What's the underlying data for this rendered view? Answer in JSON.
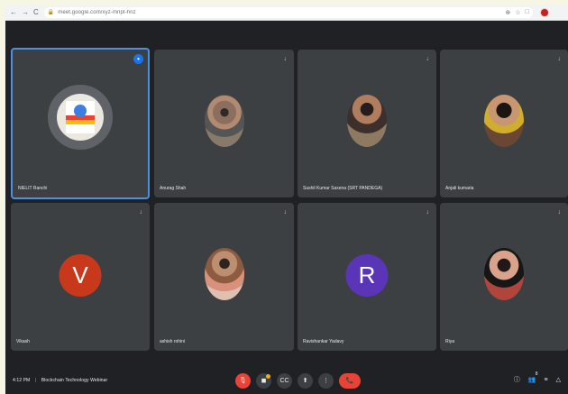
{
  "browser": {
    "url": "meet.google.com/xyz-mnpt-hnz",
    "nav_back_icon": "←",
    "nav_forward_icon": "→",
    "reload_icon": "C",
    "lock_icon": "🔒",
    "star_icon": "☆",
    "extension_icon": "⊕",
    "puzzle_icon": "□"
  },
  "participants": [
    {
      "name": "NIELIT Ranchi",
      "avatar_type": "logo",
      "active": true
    },
    {
      "name": "Anurag Shah",
      "avatar_type": "photo",
      "photo_style": "p1"
    },
    {
      "name": "Sushil Kumar Saxena (SRT PANDEGA)",
      "avatar_type": "photo",
      "photo_style": "p2"
    },
    {
      "name": "Anjali kumaria",
      "avatar_type": "photo",
      "photo_style": "p3"
    },
    {
      "name": "Vikash",
      "avatar_type": "letter",
      "letter": "V",
      "color": "#c8391c"
    },
    {
      "name": "ashish rohini",
      "avatar_type": "photo",
      "photo_style": "p4"
    },
    {
      "name": "Ravishankar Yadavy",
      "avatar_type": "letter",
      "letter": "R",
      "color": "#5b35b8"
    },
    {
      "name": "Riya",
      "avatar_type": "photo",
      "photo_style": "p5"
    }
  ],
  "bottom_bar": {
    "time": "4:12 PM",
    "title": "Blockchain Technology Webinar",
    "mic_label": "mic",
    "camera_label": "camera",
    "captions_label": "CC",
    "present_label": "present",
    "more_label": "more",
    "end_label": "end call"
  },
  "right_tools": {
    "info_icon": "ⓘ",
    "people_icon": "👥",
    "chat_icon": "≡",
    "activities_icon": "△",
    "participants_count": "8"
  }
}
